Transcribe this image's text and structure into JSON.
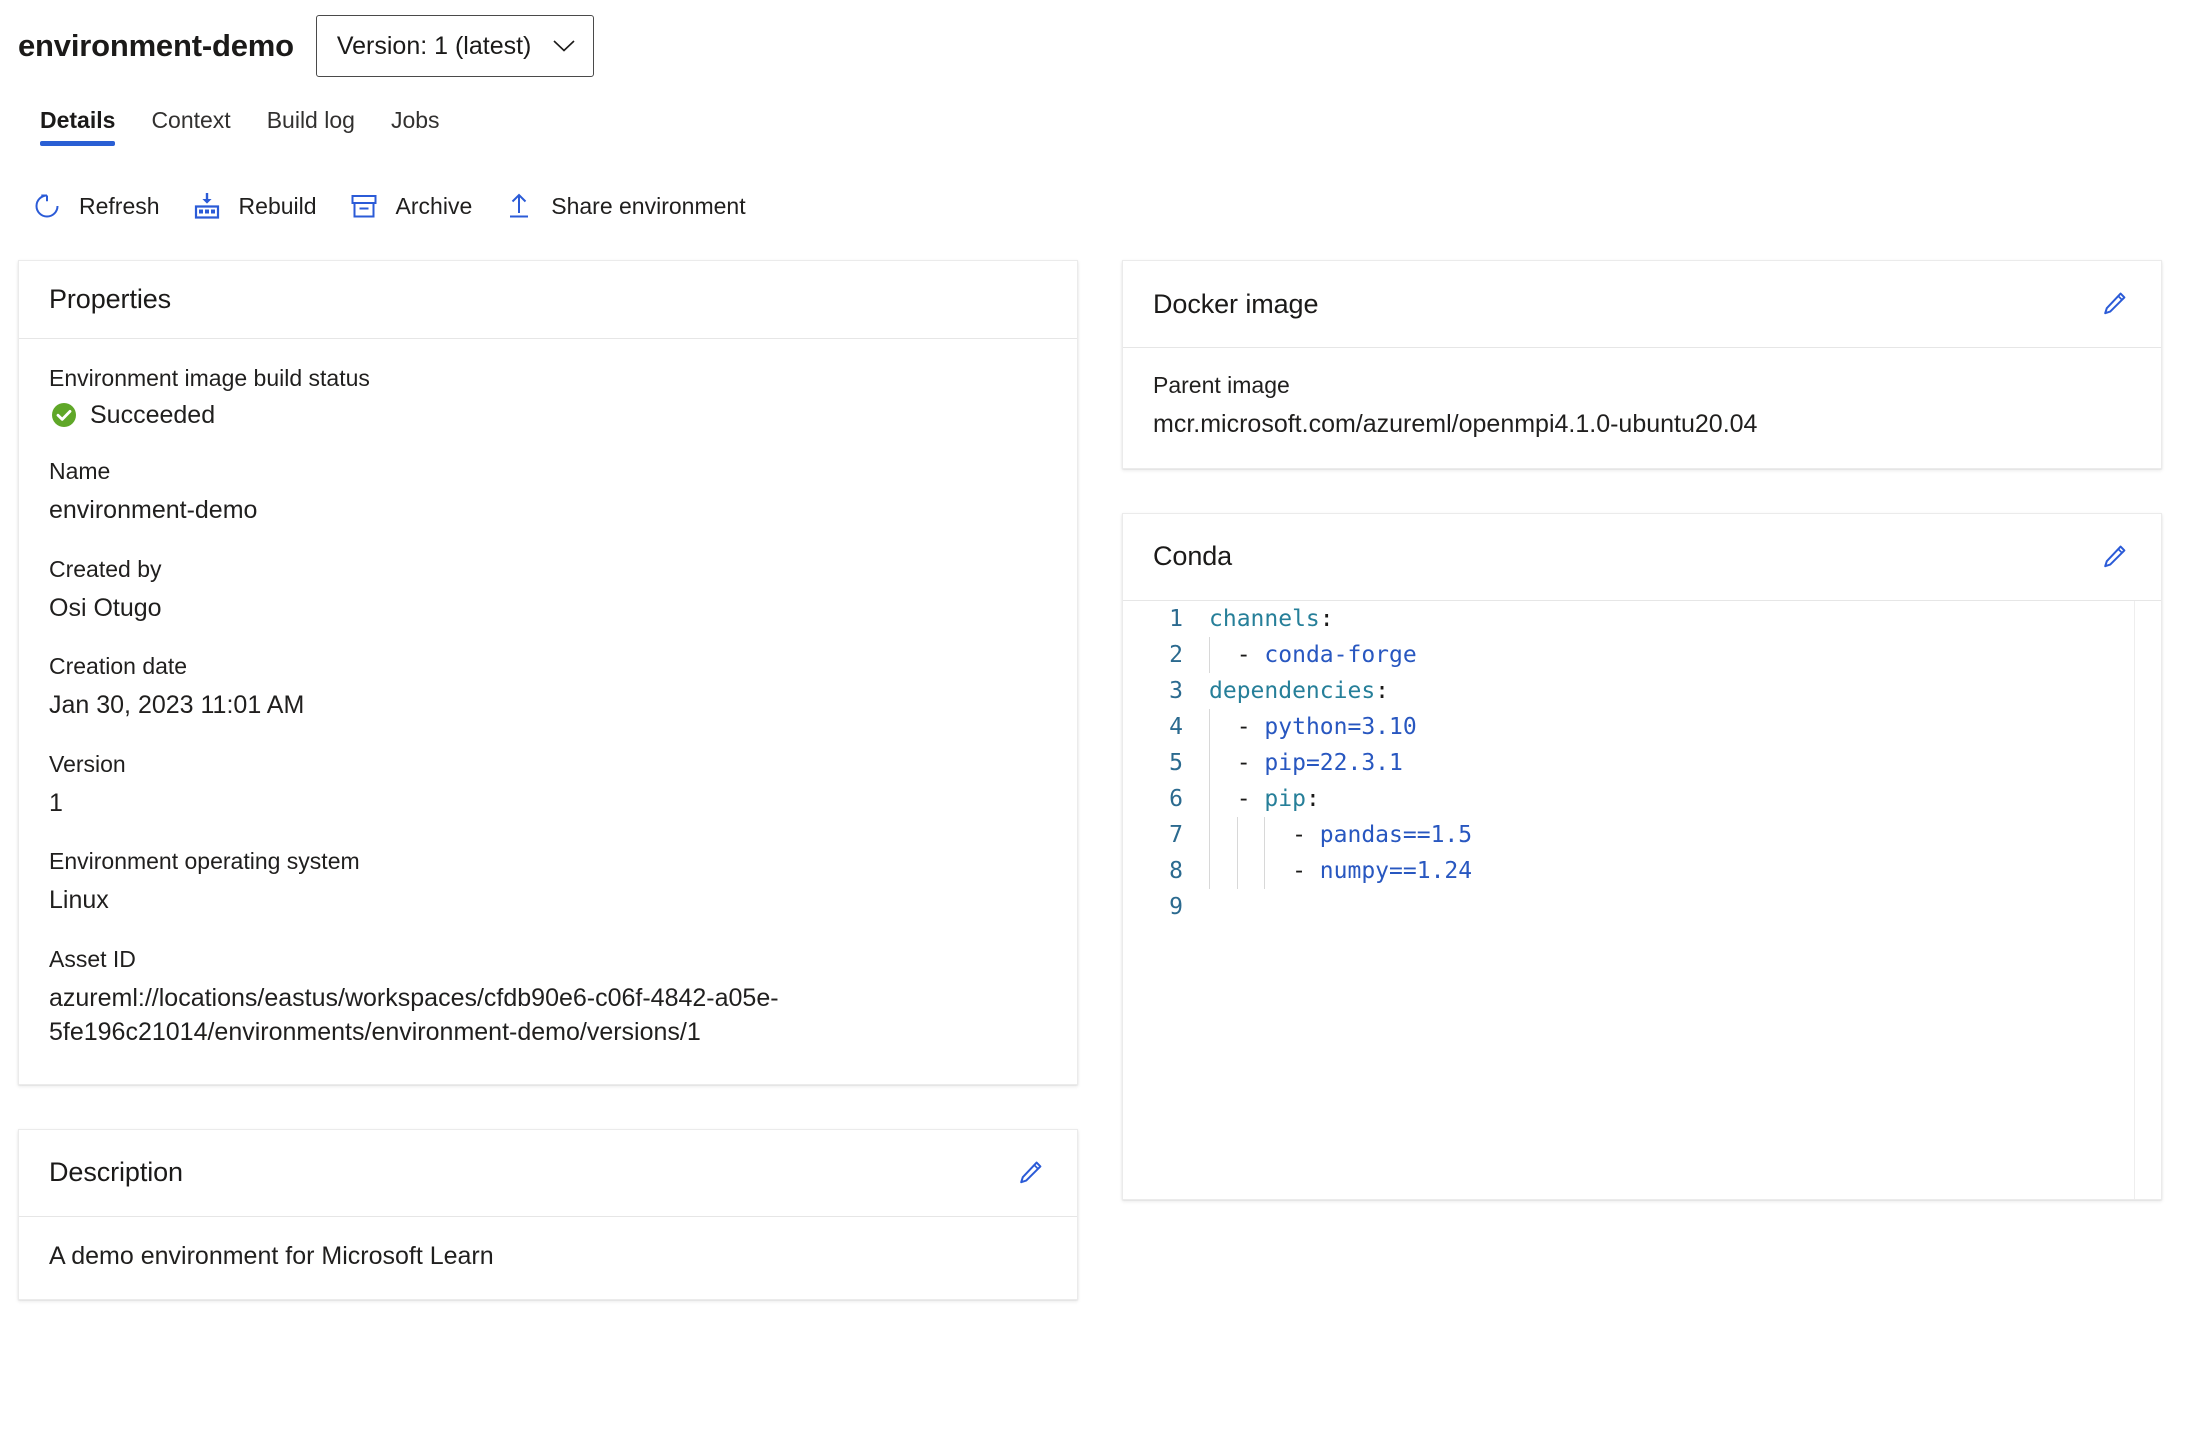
{
  "header": {
    "title": "environment-demo",
    "version_selector": {
      "label": "Version: 1 (latest)",
      "icon": "chevron-down-icon"
    }
  },
  "tabs": [
    {
      "label": "Details",
      "active": true
    },
    {
      "label": "Context",
      "active": false
    },
    {
      "label": "Build log",
      "active": false
    },
    {
      "label": "Jobs",
      "active": false
    }
  ],
  "commands": [
    {
      "label": "Refresh",
      "icon": "refresh-icon"
    },
    {
      "label": "Rebuild",
      "icon": "rebuild-icon"
    },
    {
      "label": "Archive",
      "icon": "archive-icon"
    },
    {
      "label": "Share environment",
      "icon": "upload-icon"
    }
  ],
  "properties": {
    "title": "Properties",
    "build_status": {
      "label": "Environment image build status",
      "value": "Succeeded",
      "icon": "success-check-icon",
      "color": "#5fa728"
    },
    "fields": [
      {
        "label": "Name",
        "value": "environment-demo"
      },
      {
        "label": "Created by",
        "value": "Osi Otugo"
      },
      {
        "label": "Creation date",
        "value": "Jan 30, 2023 11:01 AM"
      },
      {
        "label": "Version",
        "value": "1"
      },
      {
        "label": "Environment operating system",
        "value": "Linux"
      },
      {
        "label": "Asset ID",
        "value": "azureml://locations/eastus/workspaces/cfdb90e6-c06f-4842-a05e-5fe196c21014/environments/environment-demo/versions/1"
      }
    ]
  },
  "description": {
    "title": "Description",
    "edit_icon": "edit-pencil-icon",
    "text": "A demo environment for Microsoft Learn"
  },
  "docker": {
    "title": "Docker image",
    "edit_icon": "edit-pencil-icon",
    "parent_label": "Parent image",
    "parent_value": "mcr.microsoft.com/azureml/openmpi4.1.0-ubuntu20.04"
  },
  "conda": {
    "title": "Conda",
    "edit_icon": "edit-pencil-icon",
    "lines": [
      {
        "n": "1",
        "indent": 0,
        "guides": 0,
        "tokens": [
          {
            "t": "channels",
            "c": "k"
          },
          {
            "t": ":",
            "c": "p"
          }
        ]
      },
      {
        "n": "2",
        "indent": 1,
        "guides": 1,
        "tokens": [
          {
            "t": "- ",
            "c": "dash"
          },
          {
            "t": "conda-forge",
            "c": "v"
          }
        ]
      },
      {
        "n": "3",
        "indent": 0,
        "guides": 0,
        "tokens": [
          {
            "t": "dependencies",
            "c": "k"
          },
          {
            "t": ":",
            "c": "p"
          }
        ]
      },
      {
        "n": "4",
        "indent": 1,
        "guides": 1,
        "tokens": [
          {
            "t": "- ",
            "c": "dash"
          },
          {
            "t": "python=3.10",
            "c": "v"
          }
        ]
      },
      {
        "n": "5",
        "indent": 1,
        "guides": 1,
        "tokens": [
          {
            "t": "- ",
            "c": "dash"
          },
          {
            "t": "pip=22.3.1",
            "c": "v"
          }
        ]
      },
      {
        "n": "6",
        "indent": 1,
        "guides": 1,
        "tokens": [
          {
            "t": "- ",
            "c": "dash"
          },
          {
            "t": "pip",
            "c": "k"
          },
          {
            "t": ":",
            "c": "p"
          }
        ]
      },
      {
        "n": "7",
        "indent": 3,
        "guides": 3,
        "tokens": [
          {
            "t": "- ",
            "c": "dash"
          },
          {
            "t": "pandas==1.5",
            "c": "v"
          }
        ]
      },
      {
        "n": "8",
        "indent": 3,
        "guides": 3,
        "tokens": [
          {
            "t": "- ",
            "c": "dash"
          },
          {
            "t": "numpy==1.24",
            "c": "v"
          }
        ]
      },
      {
        "n": "9",
        "indent": 0,
        "guides": 0,
        "tokens": []
      }
    ]
  },
  "colors": {
    "accent": "#2a5fd4",
    "icon_blue": "#2b5bd7",
    "success_green": "#5fa728",
    "yaml_key": "#267f99",
    "yaml_value": "#2857c0",
    "line_number": "#2b6a8f"
  }
}
